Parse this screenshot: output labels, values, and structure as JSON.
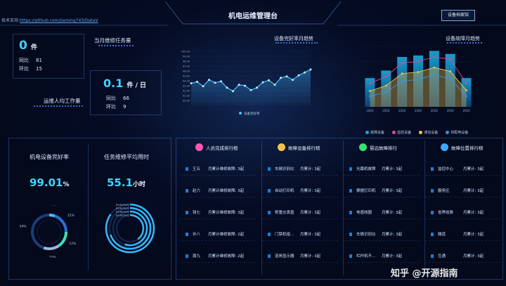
{
  "header": {
    "support_text": "技术支持:",
    "support_link": "https://github.com/jiaming743/DataV",
    "title": "机电运维管理台",
    "settings_button": "设备档案馆"
  },
  "kpi_tasks": {
    "value": "0",
    "unit": "件",
    "title": "当月维修任务量",
    "rows": [
      {
        "label": "同比",
        "value": "81"
      },
      {
        "label": "环比",
        "value": "15"
      }
    ]
  },
  "kpi_workload": {
    "value": "0.1",
    "unit": "件 / 日",
    "title": "运维人均工作量",
    "rows": [
      {
        "label": "同比",
        "value": "66"
      },
      {
        "label": "环比",
        "value": "9"
      }
    ]
  },
  "chart_data": [
    {
      "type": "line",
      "title": "设备完好率月趋势",
      "legend": [
        "设备完好率"
      ],
      "series": [
        {
          "name": "设备完好率",
          "values": [
            93.5,
            93.8,
            92.9,
            94.2,
            93.6,
            93.9,
            92.6,
            91.9,
            93.2,
            93.0,
            92.1,
            92.6,
            93.7,
            94.1,
            93.2,
            94.6,
            94.9,
            94.2,
            95.1,
            95.7,
            96.3
          ]
        }
      ],
      "y_ticks": [
        "100.00",
        "99.00",
        "98.00",
        "97.00",
        "96.00",
        "95.00",
        "94.00",
        "93.00",
        "92.00",
        "91.00",
        "90.00"
      ],
      "ylim": [
        89,
        101
      ]
    },
    {
      "type": "bar",
      "title": "设备故障月趋势",
      "categories": [
        "2020",
        "2020",
        "2020",
        "2020",
        "2020",
        "2020",
        "2020"
      ],
      "series": [
        {
          "name": "故障设备",
          "values": [
            38,
            48,
            66,
            68,
            74,
            70,
            38
          ]
        },
        {
          "name": "监控设备",
          "values": [
            31,
            40,
            58,
            60,
            66,
            63,
            31
          ]
        },
        {
          "name": "通信设备",
          "values": [
            21,
            28,
            44,
            46,
            52,
            47,
            22
          ]
        },
        {
          "name": "供配电设备",
          "values": [
            14,
            19,
            34,
            36,
            42,
            37,
            14
          ]
        }
      ],
      "legend": [
        "故障设备",
        "监控设备",
        "通信设备",
        "供配电设备"
      ],
      "ylim": [
        0,
        80
      ]
    },
    {
      "type": "pie",
      "title": "机电设备完好率",
      "value_text": "99.01",
      "value_unit": "%",
      "slice_labels": [
        "4%",
        "15%",
        "12%",
        "11%",
        "34%"
      ],
      "values": [
        4,
        15,
        12,
        11,
        34
      ]
    },
    {
      "type": "bar",
      "title": "任务维修平均用时",
      "value_text": "55.1",
      "value_unit": "小时",
      "categories": [
        "[redacted]",
        "[redacted]",
        "[redacted]",
        "[redacted]"
      ],
      "values": [
        85,
        70,
        55,
        40
      ]
    }
  ],
  "rank_panels": [
    {
      "title": "人员完成排行榜",
      "icon_color": "#ff5ab3",
      "rows": [
        {
          "name": "王五",
          "text": "月累计维修故障: 3起"
        },
        {
          "name": "赵六",
          "text": "月累计维修故障: 3起"
        },
        {
          "name": "钱七",
          "text": "月累计维修故障: 3起"
        },
        {
          "name": "孙八",
          "text": "月累计维修故障: 2起"
        },
        {
          "name": "周九",
          "text": "月累计维修故障: 2起"
        }
      ]
    },
    {
      "title": "故障设备排行榜",
      "icon_color": "#f5c14d",
      "rows": [
        {
          "name": "车辆识别仪",
          "text": "月累计: 3起"
        },
        {
          "name": "自动打印机",
          "text": "月累计: 3起"
        },
        {
          "name": "称重仪表盘",
          "text": "月累计: 3起"
        },
        {
          "name": "门禁机组...",
          "text": "月累计: 3起"
        },
        {
          "name": "道闸显示器",
          "text": "月累计: 3起"
        }
      ]
    },
    {
      "title": "慧远故障排行",
      "icon_color": "#37e36f",
      "rows": [
        {
          "name": "光幕机故障",
          "text": "月累计: 3起"
        },
        {
          "name": "票据打印机",
          "text": "月累计: 3起"
        },
        {
          "name": "地感线圈",
          "text": "月累计: 3起"
        },
        {
          "name": "车辆识别仪",
          "text": "月累计: 3起"
        },
        {
          "name": "栏杆机不...",
          "text": "月累计: 3起"
        }
      ]
    },
    {
      "title": "故障位置排行榜",
      "icon_color": "#3fa8ff",
      "rows": [
        {
          "name": "监控中心",
          "text": "月累计: 3起"
        },
        {
          "name": "服务区",
          "text": "月累计: 3起"
        },
        {
          "name": "省界收费",
          "text": "月累计: 3起"
        },
        {
          "name": "隧道",
          "text": "月累计: 3起"
        },
        {
          "name": "互通",
          "text": "月累计: 3起"
        }
      ]
    }
  ],
  "watermark": "知乎 @开源指南"
}
